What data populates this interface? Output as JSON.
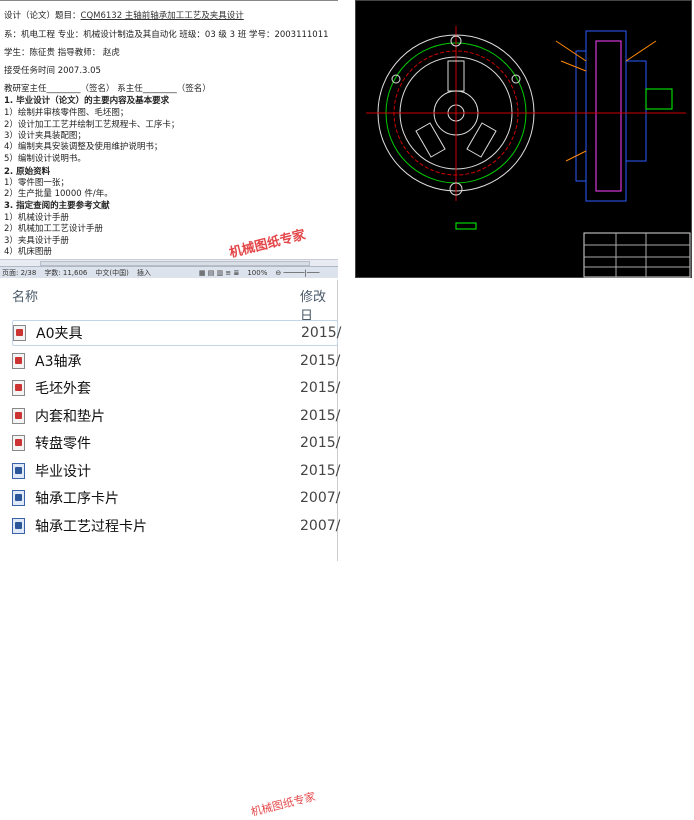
{
  "document": {
    "lines": [
      {
        "label": "设计（论文）题目：",
        "value": "CQM6132 主轴前轴承加工工艺及夹具设计"
      },
      {
        "text": "系：机电工程 专业：机械设计制造及其自动化 班级：03 级 3 班 学号：2003111011"
      },
      {
        "text": "学生：陈征贵                指导教师：   赵虎"
      },
      {
        "text": "接受任务时间 2007.3.05"
      },
      {
        "text": "教研室主任________（签名）   系主任________（签名）"
      },
      {
        "text": "1. 毕业设计（论文）的主要内容及基本要求",
        "bold": true
      },
      {
        "text": "1）绘制并审核零件图、毛坯图；"
      },
      {
        "text": "2）设计加工工艺并绘制工艺规程卡、工序卡；"
      },
      {
        "text": "3）设计夹具装配图；"
      },
      {
        "text": "4）编制夹具安装调整及使用维护说明书；"
      },
      {
        "text": "5）编制设计说明书。"
      },
      {
        "text": "2. 原始资料",
        "bold": true
      },
      {
        "text": "1）零件图一张；"
      },
      {
        "text": "2）生产批量 10000 件/年。"
      },
      {
        "text": "3. 指定查阅的主要参考文献",
        "bold": true
      },
      {
        "text": "1）机械设计手册"
      },
      {
        "text": "2）机械加工工艺设计手册"
      },
      {
        "text": "3）夹具设计手册"
      },
      {
        "text": "4）机床图册"
      }
    ],
    "status": {
      "page": "页面: 2/38",
      "words": "字数: 11,606",
      "language": "中文(中国)",
      "mode": "插入",
      "zoom": "100%"
    },
    "watermark": "机械图纸专家"
  },
  "files": {
    "headers": {
      "name": "名称",
      "modified": "修改日"
    },
    "items": [
      {
        "name": "A0夹具",
        "date": "2015/",
        "type": "cad"
      },
      {
        "name": "A3轴承",
        "date": "2015/",
        "type": "cad"
      },
      {
        "name": "毛坯外套",
        "date": "2015/",
        "type": "cad"
      },
      {
        "name": "内套和垫片",
        "date": "2015/",
        "type": "cad"
      },
      {
        "name": "转盘零件",
        "date": "2015/",
        "type": "cad"
      },
      {
        "name": "毕业设计",
        "date": "2015/",
        "type": "word"
      },
      {
        "name": "轴承工序卡片",
        "date": "2007/",
        "type": "word"
      },
      {
        "name": "轴承工艺过程卡片",
        "date": "2007/",
        "type": "word"
      }
    ],
    "watermark": "机械图纸专家"
  }
}
